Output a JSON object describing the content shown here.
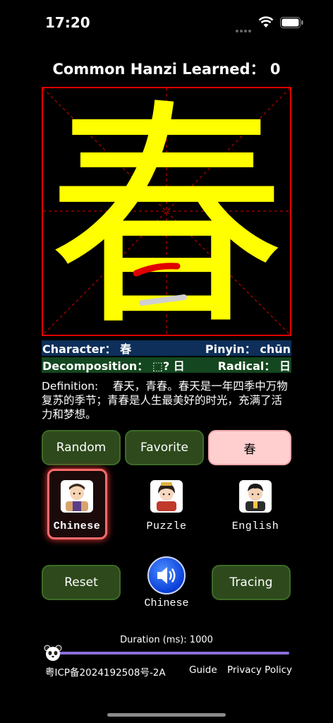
{
  "status_bar": {
    "time": "17:20"
  },
  "header": {
    "title": "Common Hanzi Learned： 0"
  },
  "hanzi": {
    "character": "春",
    "color": "#ffff00",
    "stroke_highlight": "#e00000"
  },
  "info": {
    "character_label": "Character： 春",
    "pinyin_label": "Pinyin： chūn",
    "decomposition_label": "Decomposition： ⬚? 日",
    "radical_label": "Radical： 日"
  },
  "definition": "Definition:　 春天，青春。春天是一年四季中万物复苏的季节；青春是人生最美好的时光，充满了活力和梦想。",
  "buttons": {
    "random": "Random",
    "favorite": "Favorite",
    "char": "春",
    "reset": "Reset",
    "tracing": "Tracing"
  },
  "modes": [
    {
      "label": "Chinese",
      "selected": true,
      "icon": "child-avatar-icon"
    },
    {
      "label": "Puzzle",
      "selected": false,
      "icon": "girl-avatar-icon"
    },
    {
      "label": "English",
      "selected": false,
      "icon": "boy-avatar-icon"
    }
  ],
  "speaker": {
    "label": "Chinese",
    "icon": "speaker-icon"
  },
  "duration": {
    "label": "Duration (ms): 1000",
    "value": 1000
  },
  "footer": {
    "icp": "粤ICP备2024192508号-2A",
    "guide": "Guide",
    "privacy": "Privacy Policy"
  },
  "colors": {
    "accent_green": "#2e4a1c",
    "accent_pink": "#ffcfd0",
    "grid_red": "#e00000",
    "slider": "#8b6fd9"
  }
}
